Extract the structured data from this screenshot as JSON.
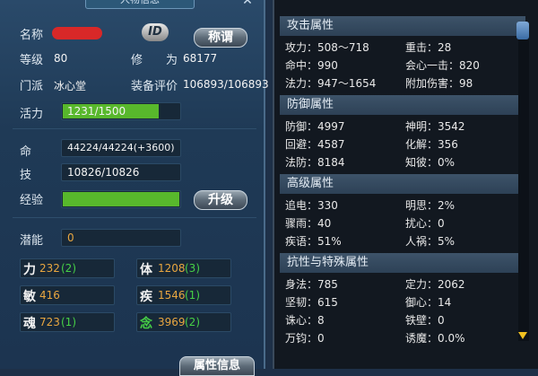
{
  "left": {
    "title": "人物信息",
    "rows": {
      "name_label": "名称",
      "id_badge": "ID",
      "title_btn": "称谓",
      "level_label": "等级",
      "level_value": "80",
      "cultivation_label": "修　　为",
      "cultivation_value": "68177",
      "faction_label": "门派",
      "faction_value": "冰心堂",
      "equip_label": "装备评价",
      "equip_value": "106893/106893",
      "vigor_label": "活力",
      "vigor_value": "1231/1500",
      "hp_label": "命",
      "hp_value": "44224/44224(+3600)",
      "skill_label": "技",
      "skill_value": "10826/10826",
      "exp_label": "经验",
      "upgrade_btn": "升级",
      "potential_label": "潜能",
      "potential_value": "0"
    },
    "attributes": [
      {
        "label": "力",
        "value": "232",
        "bonus": "(2)"
      },
      {
        "label": "体",
        "value": "1208",
        "bonus": "(3)"
      },
      {
        "label": "敏",
        "value": "416",
        "bonus": ""
      },
      {
        "label": "疾",
        "value": "1546",
        "bonus": "(1)"
      },
      {
        "label": "魂",
        "value": "723",
        "bonus": "(1)"
      },
      {
        "label": "念",
        "value": "3969",
        "bonus": "(2)"
      }
    ],
    "bottom_tab": "属性信息",
    "vigor_fill": 0.82,
    "exp_fill": 1.0,
    "colors": {
      "bar": "#58b82c",
      "stat_value": "#e8a640",
      "bonus": "#46d046"
    }
  },
  "right": {
    "sections": [
      {
        "title": "攻击属性",
        "rows": [
          [
            "攻力：508～718",
            "重击：28"
          ],
          [
            "命中：990",
            "会心一击：820"
          ],
          [
            "法力：947～1654",
            "附加伤害：98"
          ]
        ]
      },
      {
        "title": "防御属性",
        "rows": [
          [
            "防御：4997",
            "神明：3542"
          ],
          [
            "回避：4587",
            "化解：356"
          ],
          [
            "法防：8184",
            "知彼：0%"
          ]
        ]
      },
      {
        "title": "高级属性",
        "rows": [
          [
            "追电：330",
            "明思：2%"
          ],
          [
            "骤雨：40",
            "扰心：0"
          ],
          [
            "疾语：51%",
            "人祸：5%"
          ]
        ]
      },
      {
        "title": "抗性与特殊属性",
        "rows": [
          [
            "身法：785",
            "定力：2062"
          ],
          [
            "坚韧：615",
            "御心：14"
          ],
          [
            "诛心：8",
            "铁壁：0"
          ],
          [
            "万钧：0",
            "诱魔：0.0%"
          ]
        ]
      }
    ]
  }
}
